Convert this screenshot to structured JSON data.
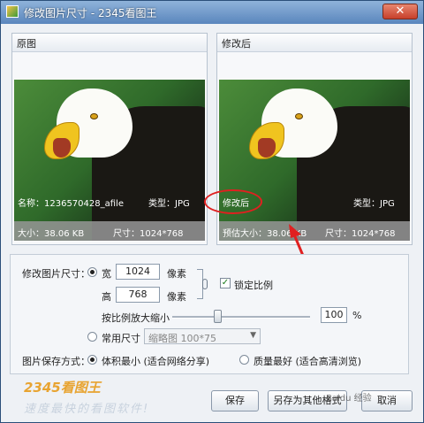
{
  "window": {
    "title": "修改图片尺寸 - 2345看图王",
    "close_glyph": "✕"
  },
  "original_panel": {
    "header": "原图",
    "name_text": "名称：1236570428_afile",
    "type_text": "类型：JPG",
    "size_text": "大小：38.06 KB",
    "dims_text": "尺寸：1024*768"
  },
  "modified_panel": {
    "header": "修改后",
    "overlay_label": "修改后",
    "type_text": "类型：JPG",
    "size_text": "预估大小：38.06 KB",
    "dims_text": "尺寸：1024*768"
  },
  "settings": {
    "resize_label": "修改图片尺寸：",
    "width_label": "宽",
    "width_value": "1024",
    "width_unit": "像素",
    "height_label": "高",
    "height_value": "768",
    "height_unit": "像素",
    "lock_ratio_label": "锁定比例",
    "lock_ratio_checked": true,
    "scale_label": "按比例放大缩小",
    "scale_value": "100",
    "scale_unit": "%",
    "slider_position": 0.33,
    "common_size_label": "常用尺寸",
    "common_size_value": "缩略图 100*75",
    "save_mode_label": "图片保存方式：",
    "save_mode_small": "体积最小 (适合网络分享)",
    "save_mode_best": "质量最好 (适合高清浏览)"
  },
  "buttons": {
    "save": "保存",
    "save_as": "另存为其他格式",
    "cancel": "取消"
  },
  "branding": {
    "logo_text": "2345看图王",
    "slogan": "速度最快的看图软件!",
    "watermark": "Baidu 经验"
  },
  "colors": {
    "annotation_red": "#e02020",
    "title_bar": "#5a86bd",
    "brand_orange": "#e8a431"
  }
}
